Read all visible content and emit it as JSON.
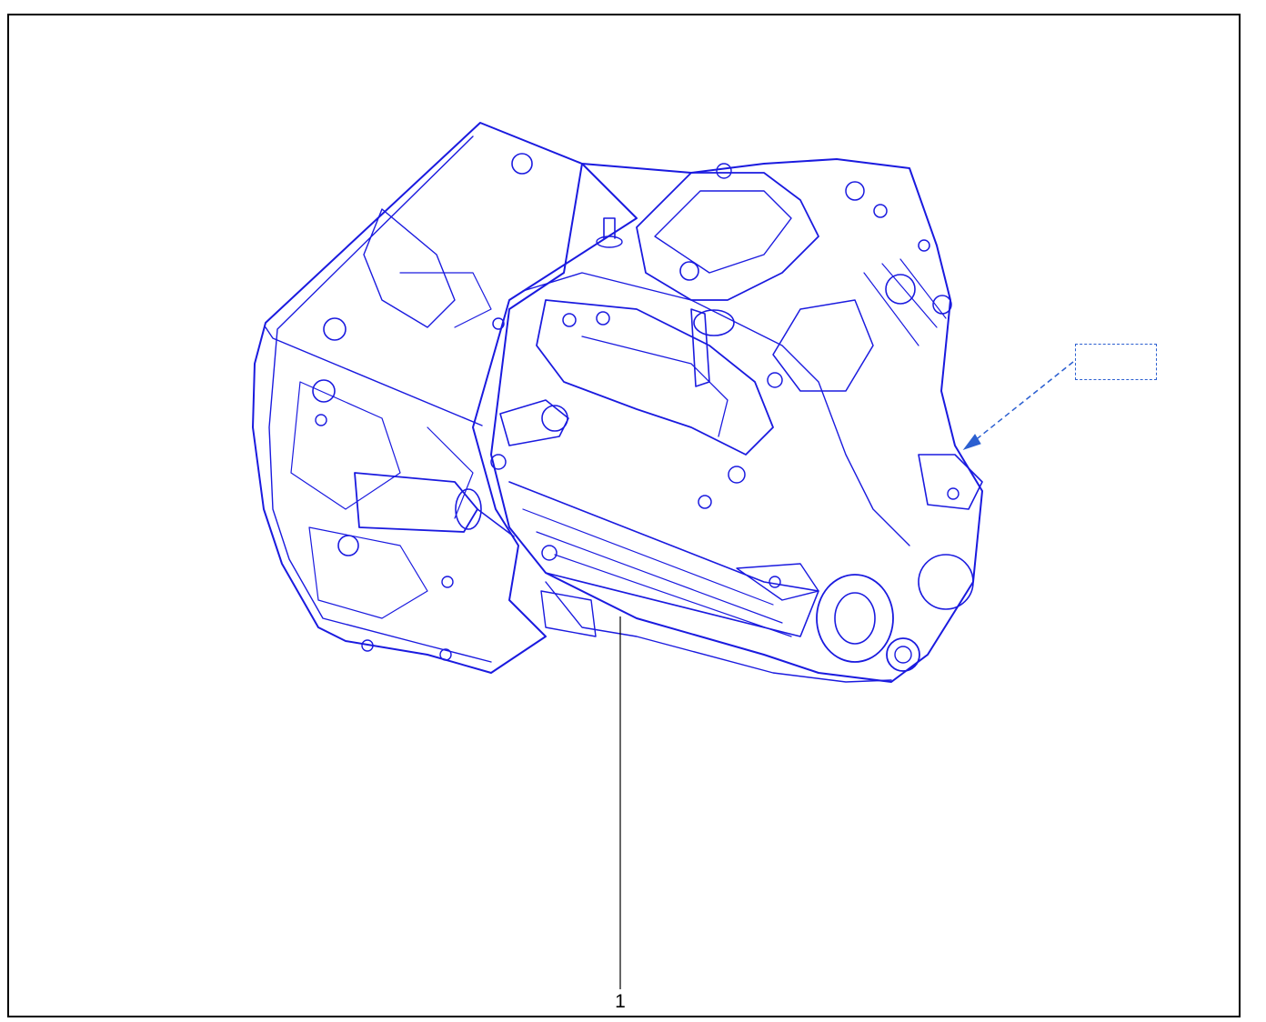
{
  "diagram": {
    "callouts": [
      {
        "number": "1",
        "part": "gearbox-assembly"
      }
    ],
    "reference_box_label": ""
  },
  "colors": {
    "line_art": "#1a1adf",
    "leader_line": "#000000",
    "reference_arrow": "#2b5fd0",
    "frame": "#000000",
    "background": "#ffffff"
  },
  "icons": {
    "part": "transmission-gearbox-illustration",
    "arrow": "dashed-arrow-icon"
  }
}
